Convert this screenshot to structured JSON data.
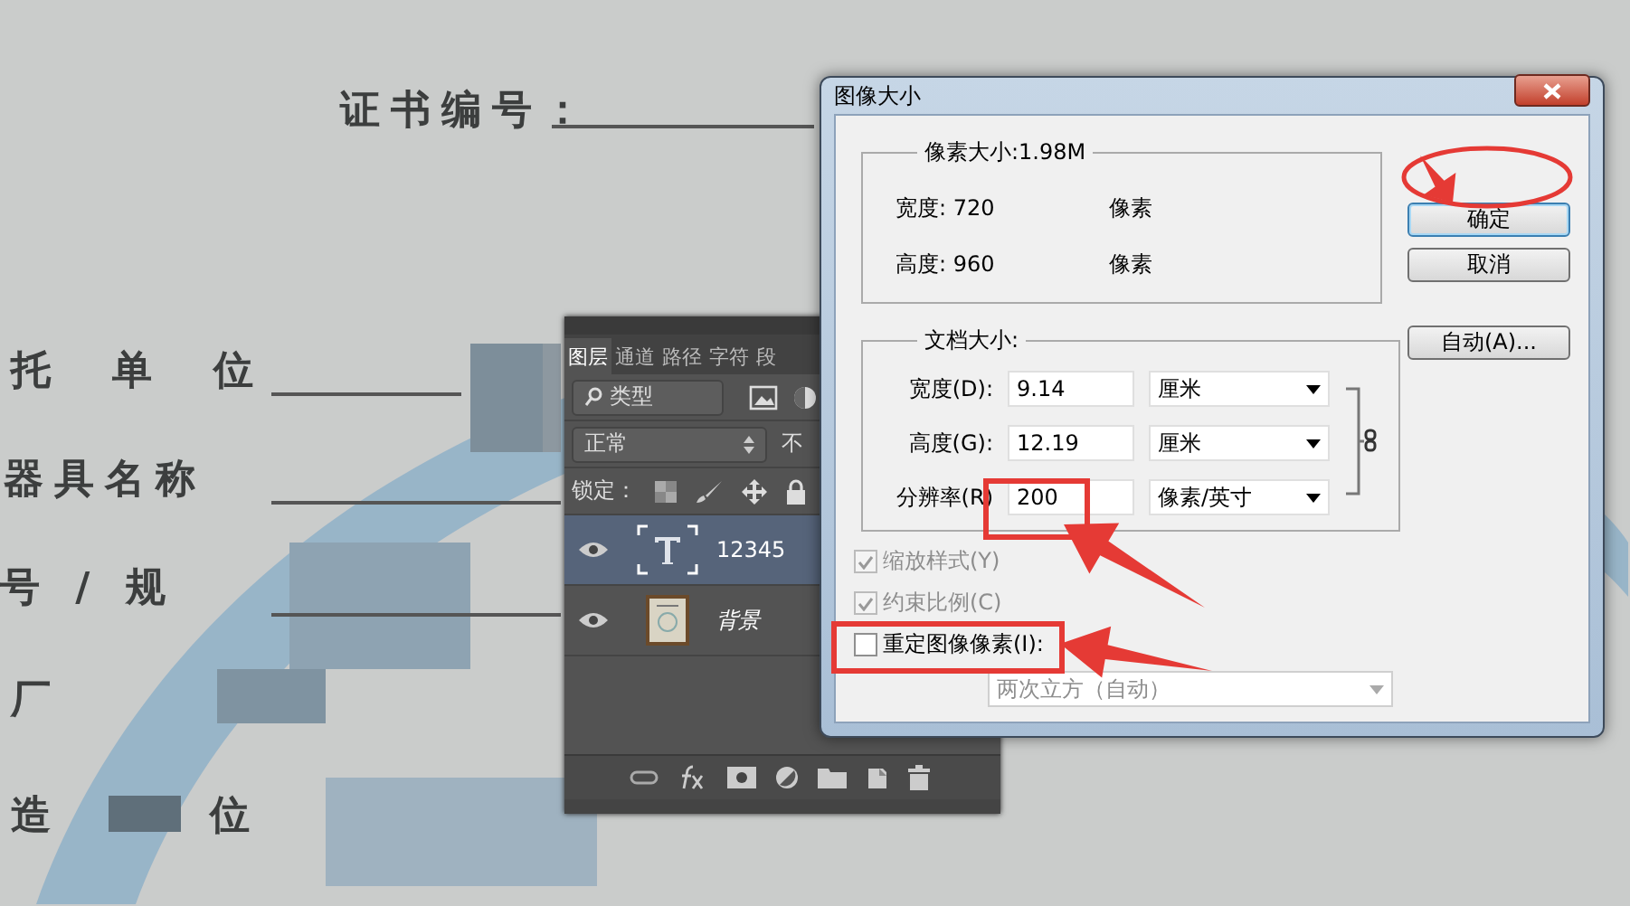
{
  "canvas": {
    "labels": [
      "证书编号：",
      "托　单　位",
      "器具名称",
      "号 / 规",
      "厂",
      "造",
      "位"
    ]
  },
  "layers_panel": {
    "tabs": [
      {
        "label": "图层",
        "selected": true
      },
      {
        "label": "通道",
        "selected": false
      },
      {
        "label": "路径",
        "selected": false
      },
      {
        "label": "字符",
        "selected": false
      },
      {
        "label": "段",
        "selected": false
      }
    ],
    "filter": "类型",
    "blend_mode": "正常",
    "opacity_label": "不",
    "lock_label": "锁定：",
    "layers": [
      {
        "name": "12345",
        "kind": "text",
        "selected": true,
        "visible": true
      },
      {
        "name": "背景",
        "kind": "image",
        "selected": false,
        "visible": true
      }
    ]
  },
  "dialog": {
    "title": "图像大小",
    "pixel_dimensions": {
      "legend": "像素大小:1.98M",
      "rows": [
        {
          "label": "宽度:",
          "value": "720",
          "unit": "像素"
        },
        {
          "label": "高度:",
          "value": "960",
          "unit": "像素"
        }
      ]
    },
    "document_size": {
      "legend": "文档大小:",
      "rows": [
        {
          "label": "宽度(D):",
          "value": "9.14",
          "unit": "厘米"
        },
        {
          "label": "高度(G):",
          "value": "12.19",
          "unit": "厘米"
        },
        {
          "label": "分辨率(R)",
          "value": "200",
          "unit": "像素/英寸"
        }
      ]
    },
    "options": [
      {
        "label": "缩放样式(Y)",
        "checked": true,
        "disabled": true
      },
      {
        "label": "约束比例(C)",
        "checked": true,
        "disabled": true
      },
      {
        "label": "重定图像像素(I):",
        "checked": false,
        "disabled": false
      }
    ],
    "resample_method": {
      "value": "两次立方（自动）",
      "disabled": true
    },
    "buttons": [
      "确定",
      "取消",
      "自动(A)..."
    ]
  }
}
